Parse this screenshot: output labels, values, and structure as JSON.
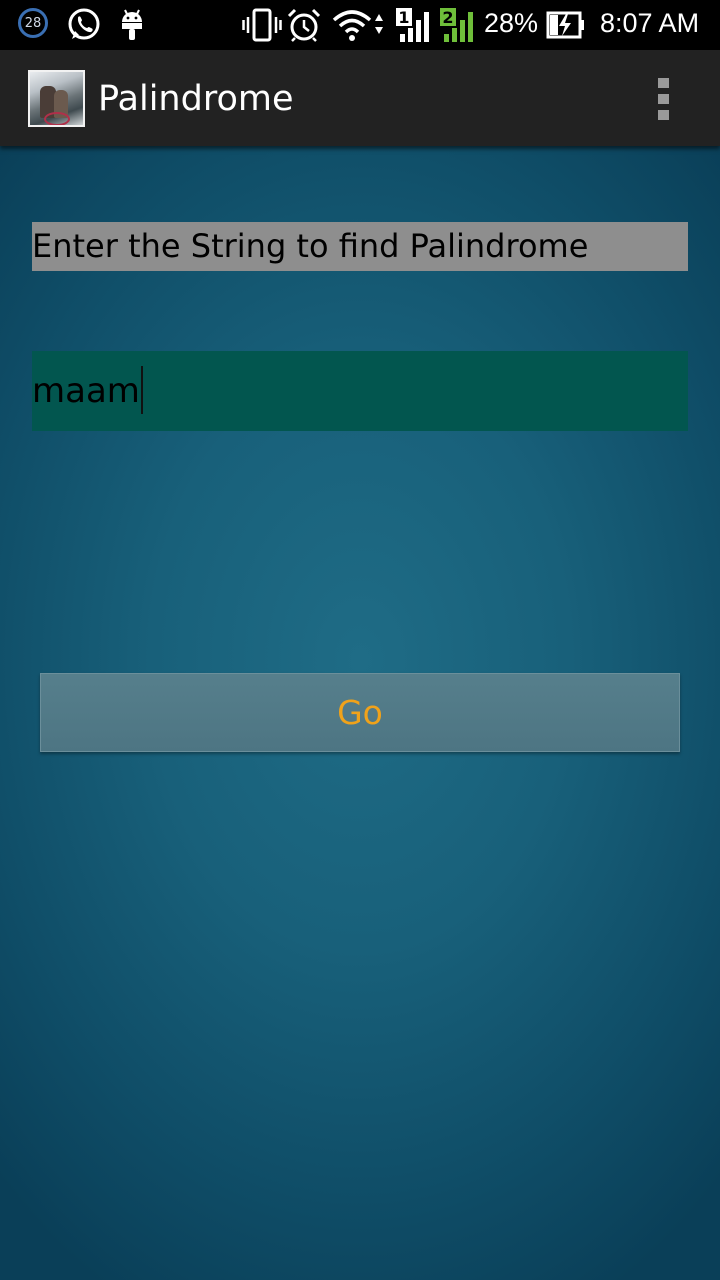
{
  "status_bar": {
    "notification_count": "28",
    "icons": [
      "notification-count-badge",
      "whatsapp-icon",
      "android-icon",
      "vibrate-icon",
      "alarm-icon",
      "wifi-icon",
      "sim1-signal-icon",
      "sim2-signal-icon",
      "battery-charging-icon"
    ],
    "sim1_label": "1",
    "sim2_label": "2",
    "battery_percent": "28%",
    "time": "8:07 AM"
  },
  "action_bar": {
    "title": "Palindrome",
    "overflow_icon": "overflow-menu-icon"
  },
  "main": {
    "prompt_label": "Enter the String to find Palindrome",
    "input_value": "maam",
    "go_button_label": "Go"
  },
  "colors": {
    "status_bar_bg": "#000000",
    "action_bar_bg": "#222222",
    "label_bg": "#8e8e8e",
    "input_bg": "#02564f",
    "button_text": "#f0a21a",
    "background": "#18607a",
    "sim2_accent": "#6fbf3a"
  }
}
